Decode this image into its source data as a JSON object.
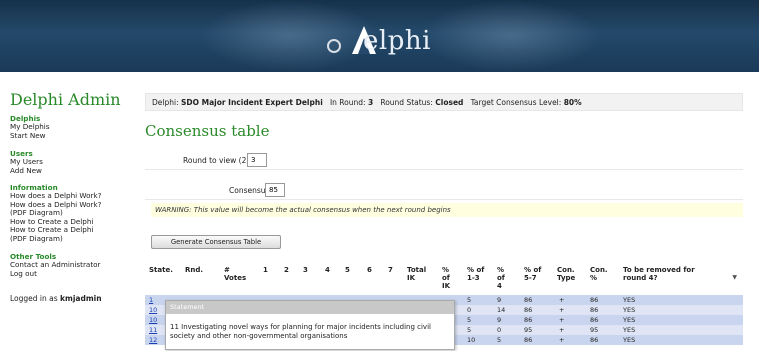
{
  "banner": {
    "logo_text": "elphi"
  },
  "sidebar": {
    "site_title": "Delphi Admin",
    "groups": [
      {
        "heading": "Delphis",
        "items": [
          "My Delphis",
          "Start New"
        ]
      },
      {
        "heading": "Users",
        "items": [
          "My Users",
          "Add New"
        ]
      },
      {
        "heading": "Information",
        "items": [
          "How does a Delphi Work?",
          "How does a Delphi Work?",
          "(PDF Diagram)",
          "How to Create a Delphi",
          "How to Create a Delphi",
          "(PDF Diagram)"
        ]
      },
      {
        "heading": "Other Tools",
        "items": [
          "Contact an Administrator",
          "Log out"
        ]
      }
    ],
    "logged_in_prefix": "Logged in as",
    "username": "kmjadmin"
  },
  "infobar": {
    "delphi_label": "Delphi:",
    "delphi_name": "SDO Major Incident Expert Delphi",
    "round_label": "In Round:",
    "round_value": "3",
    "status_label": "Round Status:",
    "status_value": "Closed",
    "target_label": "Target Consensus Level:",
    "target_value": "80%"
  },
  "page_title": "Consensus table",
  "form": {
    "round_label": "Round to view (2 to 3)",
    "round_value": "3",
    "consensus_label": "Consensus",
    "consensus_value": "85",
    "warning": "WARNING: This value will become the actual consensus when the next round begins",
    "generate_button": "Generate Consensus Table"
  },
  "table": {
    "headers": [
      "State.",
      "Rnd.",
      "# Votes",
      "1",
      "2",
      "3",
      "4",
      "5",
      "6",
      "7",
      "Total IK",
      "% of IK",
      "% of 1-3",
      "% of 4",
      "% of 5-7",
      "Con. Type",
      "Con. %",
      "To be removed for round 4?"
    ],
    "rows": [
      {
        "state": "1",
        "p13": "5",
        "p4": "9",
        "p57": "86",
        "type": "+",
        "con": "86",
        "removed": "YES"
      },
      {
        "state": "10",
        "p13": "0",
        "p4": "14",
        "p57": "86",
        "type": "+",
        "con": "86",
        "removed": "YES"
      },
      {
        "state": "10",
        "p13": "5",
        "p4": "9",
        "p57": "86",
        "type": "+",
        "con": "86",
        "removed": "YES"
      },
      {
        "state": "11",
        "p13": "5",
        "p4": "0",
        "p57": "95",
        "type": "+",
        "con": "95",
        "removed": "YES"
      },
      {
        "state": "12",
        "p13": "10",
        "p4": "5",
        "p57": "86",
        "type": "+",
        "con": "86",
        "removed": "YES"
      }
    ]
  },
  "tooltip": {
    "heading": "Statement",
    "text": "11 Investigating novel ways for planning for major incidents including civil society and other non-governmental organisations"
  }
}
